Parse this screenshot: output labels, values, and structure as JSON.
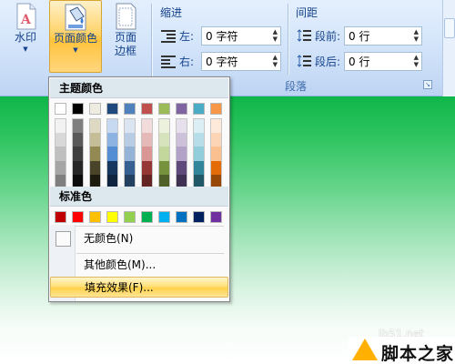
{
  "ribbon": {
    "buttons": {
      "watermark": {
        "label": "水印",
        "arrow": "▼"
      },
      "page_color": {
        "label": "页面颜色",
        "arrow": "▼"
      },
      "page_border": {
        "label_line1": "页面",
        "label_line2": "边框"
      }
    },
    "paragraph_group": {
      "title": "段落",
      "indent": {
        "heading": "缩进",
        "left_label": "左:",
        "left_value": "0 字符",
        "right_label": "右:",
        "right_value": "0 字符"
      },
      "spacing": {
        "heading": "间距",
        "before_label": "段前:",
        "before_value": "0 行",
        "after_label": "段后:",
        "after_value": "0 行"
      }
    }
  },
  "menu": {
    "theme_colors_header": "主题颜色",
    "standard_colors_header": "标准色",
    "theme_top_row": [
      "#ffffff",
      "#000000",
      "#eeece1",
      "#1f497d",
      "#4f81bd",
      "#c0504d",
      "#9bbb59",
      "#8064a2",
      "#4bacc6",
      "#f79646"
    ],
    "theme_tints": [
      [
        "#f2f2f2",
        "#d8d8d8",
        "#bfbfbf",
        "#a5a5a5",
        "#7f7f7f"
      ],
      [
        "#7f7f7f",
        "#595959",
        "#3f3f3f",
        "#262626",
        "#0c0c0c"
      ],
      [
        "#ddd9c3",
        "#c4bd97",
        "#938953",
        "#494429",
        "#1d1b10"
      ],
      [
        "#c6d9f0",
        "#8db3e2",
        "#548dd4",
        "#17365d",
        "#0f243e"
      ],
      [
        "#dbe5f1",
        "#b8cce4",
        "#95b3d7",
        "#366092",
        "#244061"
      ],
      [
        "#f2dcdb",
        "#e5b9b7",
        "#d99694",
        "#953734",
        "#632423"
      ],
      [
        "#ebf1dd",
        "#d7e3bc",
        "#c3d69b",
        "#76923c",
        "#4f6128"
      ],
      [
        "#e5e0ec",
        "#ccc1d9",
        "#b2a2c7",
        "#5f497a",
        "#3f3151"
      ],
      [
        "#dbeef3",
        "#b7dde8",
        "#92cddc",
        "#31859b",
        "#205867"
      ],
      [
        "#fdeada",
        "#fbd5b5",
        "#fac08f",
        "#e36c09",
        "#974806"
      ]
    ],
    "standard_colors": [
      "#c00000",
      "#ff0000",
      "#ffc000",
      "#ffff00",
      "#92d050",
      "#00b050",
      "#00b0f0",
      "#0070c0",
      "#002060",
      "#7030a0"
    ],
    "items": {
      "no_color": "无颜色(N)",
      "more_colors": "其他颜色(M)...",
      "fill_effects": "填充效果(F)..."
    }
  },
  "watermark": {
    "url": "jb51.net",
    "brand": "脚本之家"
  }
}
